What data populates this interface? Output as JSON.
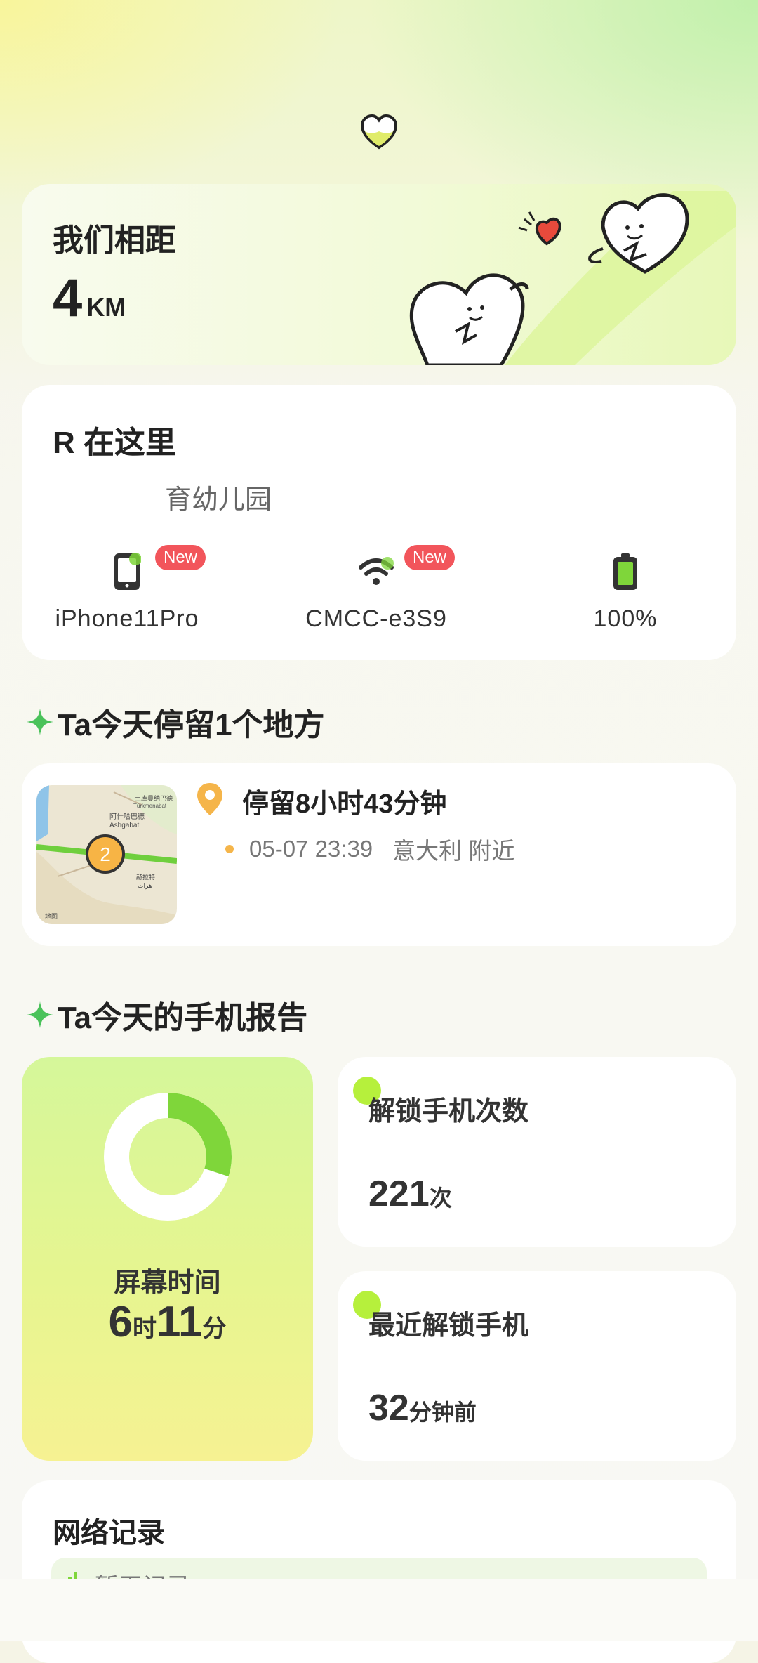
{
  "distance_card": {
    "title": "我们相距",
    "value": "4",
    "unit": "KM"
  },
  "location_card": {
    "title": "R 在这里",
    "address": "育幼儿园",
    "devices": [
      {
        "icon": "phone-icon",
        "label": "iPhone11Pro",
        "badge": "New"
      },
      {
        "icon": "wifi-icon",
        "label": "CMCC-e3S9",
        "badge": "New"
      },
      {
        "icon": "battery-icon",
        "label": "100%"
      }
    ]
  },
  "stay_section": {
    "title": "Ta今天停留1个地方",
    "item": {
      "duration": "停留8小时43分钟",
      "time": "05-07 23:39",
      "place": "意大利 附近",
      "map_badge": "2",
      "map_labels": [
        "土库曼纳巴德",
        "Türkmenabat",
        "阿什哈巴德",
        "Ashgabat",
        "赫拉特",
        "هرات",
        "地图"
      ]
    }
  },
  "report_section": {
    "title": "Ta今天的手机报告",
    "screen_time": {
      "label": "屏幕时间",
      "hours": "6",
      "hours_unit": "时",
      "minutes": "11",
      "minutes_unit": "分",
      "progress": 0.3
    },
    "unlock_count": {
      "label": "解锁手机次数",
      "value": "221",
      "unit": "次"
    },
    "last_unlock": {
      "label": "最近解锁手机",
      "value": "32",
      "unit": "分钟前"
    }
  },
  "network_card": {
    "title": "网络记录",
    "empty_text": "暂无记录"
  },
  "colors": {
    "accent_green": "#7fd63a",
    "badge_red": "#f2555b",
    "pin_orange": "#f5b54a"
  }
}
